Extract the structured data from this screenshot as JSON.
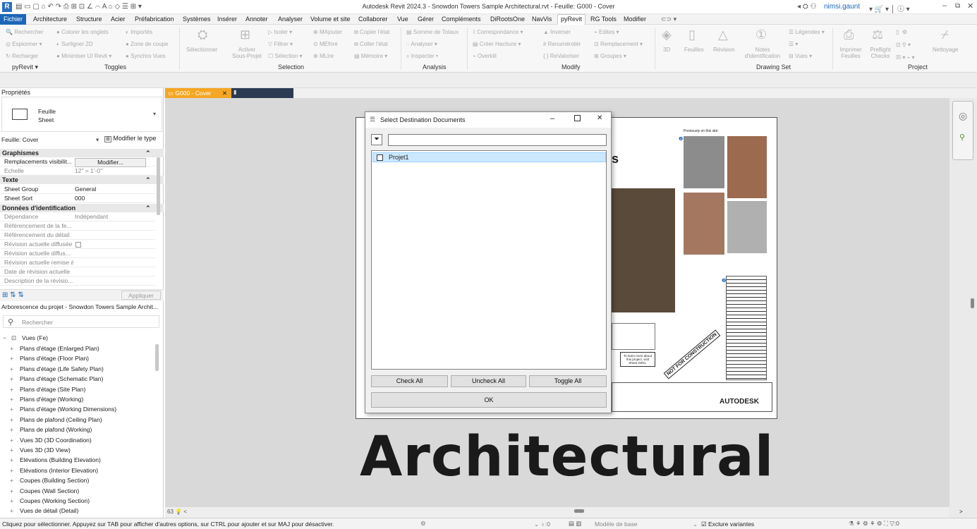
{
  "app": {
    "title": "Autodesk Revit 2024.3 - Snowdon Towers Sample Architectural.rvt - Feuille: G000 - Cover",
    "user": "nimsi.gaunt",
    "logo_letter": "R"
  },
  "menu": {
    "items": [
      "Fichier",
      "Architecture",
      "Structure",
      "Acier",
      "Préfabrication",
      "Systèmes",
      "Insérer",
      "Annoter",
      "Analyser",
      "Volume et site",
      "Collaborer",
      "Vue",
      "Gérer",
      "Compléments",
      "DiRootsOne",
      "NavVis",
      "pyRevit",
      "RG Tools",
      "Modifier"
    ],
    "active": "pyRevit"
  },
  "ribbon": {
    "col1": [
      "Rechercher",
      "Espionner",
      "Recharger"
    ],
    "col2": [
      "Colorer les onglets",
      "Surligner 2D",
      "Minimiser UI Revit"
    ],
    "col3": [
      "Importés",
      "Zone de coupe",
      "Synchro Vues"
    ],
    "selection_big": [
      "Sélectionner",
      "Activer Sous-Projet"
    ],
    "col4": [
      "Isoler",
      "Filtrer",
      "Sélection"
    ],
    "col5": [
      "MAjouter",
      "MEfrire",
      "MLire"
    ],
    "col6": [
      "Copier l'état",
      "Coller l'état",
      "Mémoire"
    ],
    "col7": [
      "Somme de Totaux",
      "Analyser",
      "Inspecter"
    ],
    "col8": [
      "Correspondance",
      "Créer Hachure",
      "Overkill"
    ],
    "col9": [
      "Inverser",
      "Renumérotér",
      "ReValoriser"
    ],
    "col10": [
      "Edites",
      "Remplacement",
      "Groupes"
    ],
    "drawing_big": [
      "3D",
      "Feuilles",
      "Révision",
      "Notes d'identification"
    ],
    "col11": [
      "Légendes",
      "",
      "Vues"
    ],
    "project_big": [
      "Imprimer Feuilles",
      "Preflight Checks",
      "Nettoyage"
    ],
    "panels": [
      "pyRevit",
      "Toggles",
      "Selection",
      "Analysis",
      "Modify",
      "Drawing Set",
      "Project"
    ]
  },
  "properties": {
    "header": "Propriétés",
    "type_line1": "Feuille",
    "type_line2": "Sheet",
    "selector": "Feuille: Cover",
    "edit_type": "Modifier le type",
    "sections": {
      "graphismes": "Graphismes",
      "texte": "Texte",
      "identification": "Données d'identification"
    },
    "rows_graph": [
      {
        "k": "Remplacements visibilit...",
        "v": "Modifier..."
      },
      {
        "k": "Echelle",
        "v": "12\" = 1'-0\""
      }
    ],
    "rows_text": [
      {
        "k": "Sheet Group",
        "v": "General"
      },
      {
        "k": "Sheet Sort",
        "v": "000"
      }
    ],
    "rows_id": [
      {
        "k": "Dépendance",
        "v": "Indépendant"
      },
      {
        "k": "Référencement de la fe...",
        "v": ""
      },
      {
        "k": "Référencement du détail",
        "v": ""
      },
      {
        "k": "Révision actuelle diffusée",
        "v": ""
      },
      {
        "k": "Révision actuelle diffus...",
        "v": ""
      },
      {
        "k": "Révision actuelle remise à",
        "v": ""
      },
      {
        "k": "Date de révision actuelle",
        "v": ""
      },
      {
        "k": "Description de la révisio...",
        "v": ""
      }
    ],
    "apply": "Appliquer"
  },
  "browser": {
    "header": "Arborescence du projet - Snowdon Towers Sample Archit...",
    "search_placeholder": "Rechercher",
    "root": "Vues (Fe)",
    "items": [
      "Plans d'étage (Enlarged Plan)",
      "Plans d'étage (Floor Plan)",
      "Plans d'étage (Life Safety Plan)",
      "Plans d'étage (Schematic Plan)",
      "Plans d'étage (Site Plan)",
      "Plans d'étage (Working)",
      "Plans d'étage (Working Dimensions)",
      "Plans de plafond (Ceiling Plan)",
      "Plans de plafond (Working)",
      "Vues 3D (3D Coordination)",
      "Vues 3D (3D View)",
      "Elévations (Building Elevation)",
      "Elévations (Interior Elevation)",
      "Coupes (Building Section)",
      "Coupes (Wall Section)",
      "Coupes (Working Section)",
      "Vues de détail (Detail)"
    ]
  },
  "view_tab": "G000 - Cover",
  "sheet": {
    "big_word": "Architectural",
    "previously": "Previously on this site:",
    "not_for_construction": "NOT FOR CONSTRUCTION",
    "learn_more": "To learn more about this project, visit Sheet G001.",
    "brand": "AUTODESK",
    "title_letter": "s"
  },
  "dialog": {
    "title": "Select Destination Documents",
    "filter_value": "",
    "items": [
      {
        "label": "Projet1",
        "checked": false
      }
    ],
    "check_all": "Check All",
    "uncheck_all": "Uncheck All",
    "toggle_all": "Toggle All",
    "ok": "OK"
  },
  "status": {
    "text": "Cliquez pour sélectionner. Appuyez sur TAB pour afficher d'autres options, sur CTRL pour ajouter et sur MAJ pour désactiver.",
    "zero1": ":0",
    "model": "Modèle de base",
    "exclude": "Exclure variantes",
    "zero2": ":0"
  }
}
